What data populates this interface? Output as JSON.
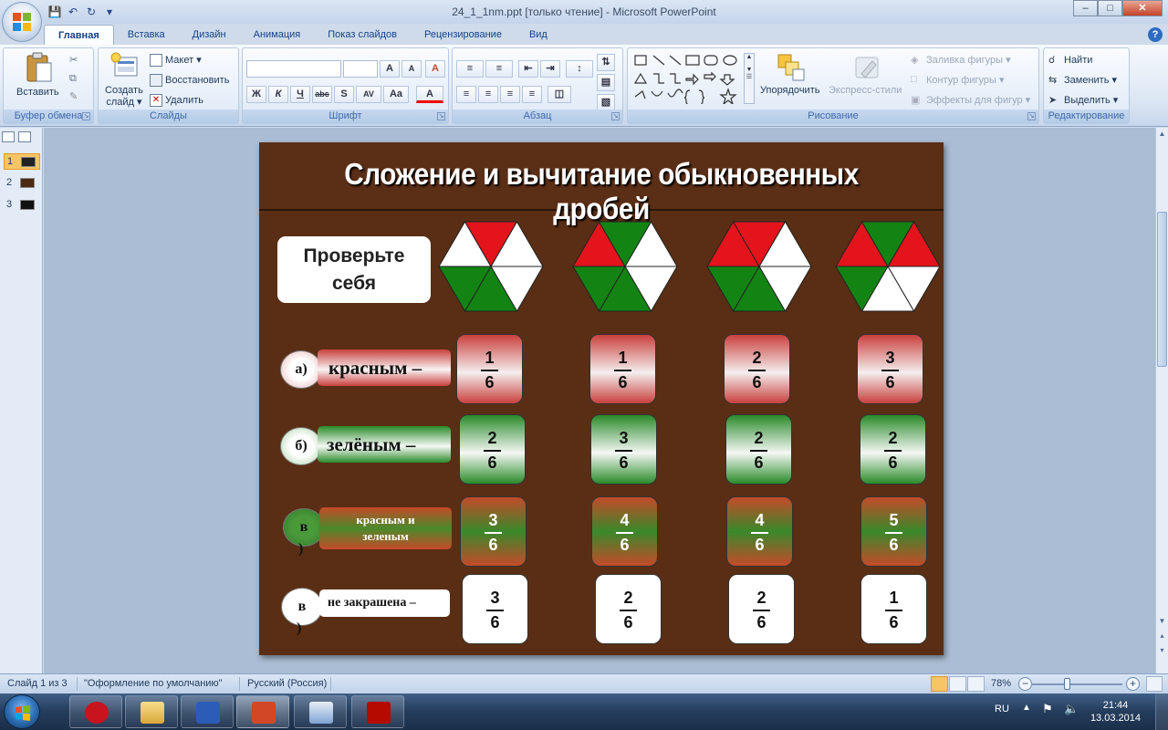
{
  "window": {
    "title": "24_1_1nm.ppt [только чтение] - Microsoft PowerPoint"
  },
  "ribbon": {
    "tabs": [
      {
        "label": "Главная",
        "active": true
      },
      {
        "label": "Вставка",
        "active": false
      },
      {
        "label": "Дизайн",
        "active": false
      },
      {
        "label": "Анимация",
        "active": false
      },
      {
        "label": "Показ слайдов",
        "active": false
      },
      {
        "label": "Рецензирование",
        "active": false
      },
      {
        "label": "Вид",
        "active": false
      }
    ],
    "clipboard": {
      "label": "Буфер обмена",
      "paste": "Вставить"
    },
    "slides": {
      "label": "Слайды",
      "new_slide_1": "Создать",
      "new_slide_2": "слайд",
      "layout": "Макет",
      "reset": "Восстановить",
      "delete": "Удалить"
    },
    "font": {
      "label": "Шрифт",
      "bold": "Ж",
      "italic": "К",
      "underline": "Ч",
      "strike": "abc",
      "shadow": "S",
      "spacing": "AV",
      "case": "Aa",
      "grow": "A",
      "shrink": "A",
      "clear": "A",
      "color": "A"
    },
    "paragraph": {
      "label": "Абзац"
    },
    "drawing": {
      "label": "Рисование",
      "arrange": "Упорядочить",
      "quick_styles": "Экспресс-стили",
      "fill": "Заливка фигуры",
      "outline": "Контур фигуры",
      "effects": "Эффекты для фигур"
    },
    "editing": {
      "label": "Редактирование",
      "find": "Найти",
      "replace": "Заменить",
      "select": "Выделить"
    }
  },
  "slides_panel": {
    "items": [
      {
        "num": "1",
        "selected": true
      },
      {
        "num": "2",
        "selected": false
      },
      {
        "num": "3",
        "selected": false
      }
    ]
  },
  "slide": {
    "title": "Сложение и вычитание обыкновенных дробей",
    "check": {
      "line1": "Проверьте",
      "line2": "себя"
    },
    "hexagons": [
      {
        "colors": [
          "white",
          "white",
          "white",
          "green",
          "green",
          "red"
        ]
      },
      {
        "colors": [
          "red",
          "white",
          "white",
          "green",
          "green",
          "green"
        ]
      },
      {
        "colors": [
          "red",
          "white",
          "white",
          "green",
          "green",
          "red"
        ]
      },
      {
        "colors": [
          "red",
          "red",
          "white",
          "white",
          "green",
          "green"
        ]
      }
    ],
    "rows": [
      {
        "letter": "а)",
        "label": "красным –",
        "style": "red",
        "fractions": [
          {
            "n": "1",
            "d": "6"
          },
          {
            "n": "1",
            "d": "6"
          },
          {
            "n": "2",
            "d": "6"
          },
          {
            "n": "3",
            "d": "6"
          }
        ]
      },
      {
        "letter": "б)",
        "label": "зелёным –",
        "style": "green",
        "fractions": [
          {
            "n": "2",
            "d": "6"
          },
          {
            "n": "3",
            "d": "6"
          },
          {
            "n": "2",
            "d": "6"
          },
          {
            "n": "2",
            "d": "6"
          }
        ]
      },
      {
        "letter": "в",
        "letter2": ")",
        "label": "красным и зеленым",
        "style": "mix",
        "fractions": [
          {
            "n": "3",
            "d": "6"
          },
          {
            "n": "4",
            "d": "6"
          },
          {
            "n": "4",
            "d": "6"
          },
          {
            "n": "5",
            "d": "6"
          }
        ]
      },
      {
        "letter": "в",
        "letter2": ")",
        "label": "не закрашена –",
        "style": "white",
        "fractions": [
          {
            "n": "3",
            "d": "6"
          },
          {
            "n": "2",
            "d": "6"
          },
          {
            "n": "2",
            "d": "6"
          },
          {
            "n": "1",
            "d": "6"
          }
        ]
      }
    ]
  },
  "status": {
    "slide_info": "Слайд 1 из 3",
    "theme": "\"Оформление по умолчанию\"",
    "language": "Русский (Россия)",
    "zoom": "78%"
  },
  "taskbar": {
    "lang": "RU",
    "time": "21:44",
    "date": "13.03.2014"
  },
  "colors": {
    "red": "#e3141b",
    "green": "#138413",
    "slide_bg": "#5a2e14"
  }
}
